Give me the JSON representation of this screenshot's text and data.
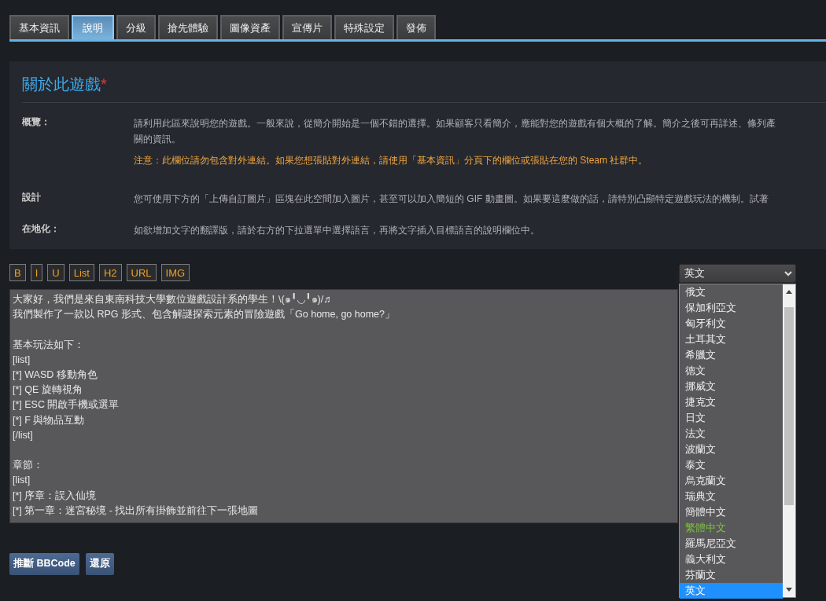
{
  "tabs": [
    {
      "label": "基本資訊",
      "selected": false
    },
    {
      "label": "說明",
      "selected": true
    },
    {
      "label": "分級",
      "selected": false
    },
    {
      "label": "搶先體驗",
      "selected": false
    },
    {
      "label": "圖像資產",
      "selected": false
    },
    {
      "label": "宣傳片",
      "selected": false
    },
    {
      "label": "特殊設定",
      "selected": false
    },
    {
      "label": "發佈",
      "selected": false
    }
  ],
  "about": {
    "title": "關於此遊戲",
    "required_mark": "*",
    "rows": [
      {
        "label": "概覽：",
        "lines": [
          "請利用此區來說明您的遊戲。一般來說，從簡介開始是一個不錯的選擇。如果顧客只看簡介，應能對您的遊戲有個大概的了解。簡介之後可再詳述、條列產",
          "關的資訊。"
        ],
        "notice": "注意：此欄位請勿包含對外連結。如果您想張貼對外連結，請使用「基本資訊」分頁下的欄位或張貼在您的 Steam 社群中。"
      },
      {
        "label": "設計",
        "lines": [
          "您可使用下方的「上傳自訂圖片」區塊在此空間加入圖片，甚至可以加入簡短的 GIF 動畫圖。如果要這麼做的話，請特別凸顯特定遊戲玩法的機制。試著"
        ]
      },
      {
        "label": "在地化：",
        "lines": [
          "如欲增加文字的翻譯版，請於右方的下拉選單中選擇語言，再將文字插入目標語言的說明欄位中。"
        ]
      }
    ]
  },
  "format_buttons": [
    "B",
    "I",
    "U",
    "List",
    "H2",
    "URL",
    "IMG"
  ],
  "editor": {
    "blocks": [
      [
        "大家好，我們是來自東南科技大學數位遊戲設計系的學生！\\(๑╹◡╹๑)/♬",
        "我們製作了一款以 RPG 形式、包含解謎探索元素的冒險遊戲「Go home, go home?」"
      ],
      [
        "基本玩法如下：",
        "[list]",
        "[*] WASD 移動角色",
        "[*] QE 旋轉視角",
        "[*] ESC 開啟手機或選單",
        "[*] F 與物品互動",
        "[/list]"
      ],
      [
        "章節：",
        "[list]",
        "[*] 序章：誤入仙境",
        "[*] 第一章：迷宮秘境 - 找出所有掛飾並前往下一張地圖"
      ]
    ]
  },
  "language_select": {
    "value": "英文",
    "options": [
      {
        "label": "俄文",
        "selected": false,
        "has_content": false
      },
      {
        "label": "保加利亞文",
        "selected": false,
        "has_content": false
      },
      {
        "label": "匈牙利文",
        "selected": false,
        "has_content": false
      },
      {
        "label": "土耳其文",
        "selected": false,
        "has_content": false
      },
      {
        "label": "希臘文",
        "selected": false,
        "has_content": false
      },
      {
        "label": "德文",
        "selected": false,
        "has_content": false
      },
      {
        "label": "挪威文",
        "selected": false,
        "has_content": false
      },
      {
        "label": "捷克文",
        "selected": false,
        "has_content": false
      },
      {
        "label": "日文",
        "selected": false,
        "has_content": false
      },
      {
        "label": "法文",
        "selected": false,
        "has_content": false
      },
      {
        "label": "波蘭文",
        "selected": false,
        "has_content": false
      },
      {
        "label": "泰文",
        "selected": false,
        "has_content": false
      },
      {
        "label": "烏克蘭文",
        "selected": false,
        "has_content": false
      },
      {
        "label": "瑞典文",
        "selected": false,
        "has_content": false
      },
      {
        "label": "簡體中文",
        "selected": false,
        "has_content": false
      },
      {
        "label": "繁體中文",
        "selected": false,
        "has_content": true
      },
      {
        "label": "羅馬尼亞文",
        "selected": false,
        "has_content": false
      },
      {
        "label": "義大利文",
        "selected": false,
        "has_content": false
      },
      {
        "label": "芬蘭文",
        "selected": false,
        "has_content": false
      },
      {
        "label": "英文",
        "selected": true,
        "has_content": false
      }
    ]
  },
  "actions": [
    "推斷 BBCode",
    "還原"
  ]
}
